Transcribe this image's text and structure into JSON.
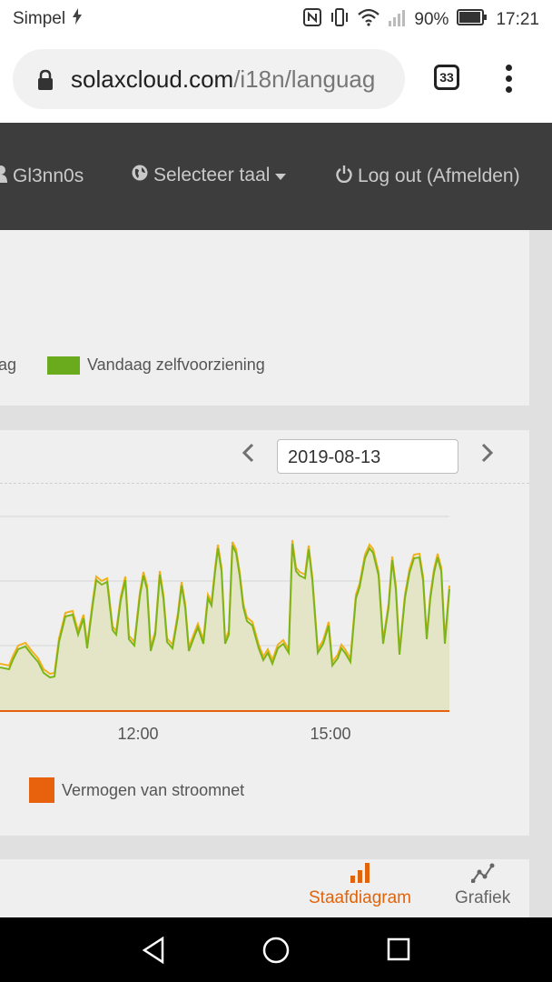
{
  "status_bar": {
    "carrier": "Simpel",
    "battery_percent": "90%",
    "time": "17:21",
    "icons": [
      "charging-bolt-icon",
      "nfc-icon",
      "vibrate-icon",
      "wifi-icon",
      "signal-icon",
      "battery-icon"
    ]
  },
  "browser": {
    "url_domain": "solaxcloud.com",
    "url_path": "/i18n/languag",
    "tab_count": "33"
  },
  "site_nav": {
    "user": "Gl3nn0s",
    "language": "Selecteer taal",
    "logout": "Log out (Afmelden)"
  },
  "summary_panel": {
    "legend_partial": "ag",
    "legend_selfsufficiency": "Vandaag zelfvoorziening",
    "legend_color": "#6aaa1d"
  },
  "power_panel": {
    "date": "2019-08-13",
    "legend_grid": "Vermogen van stroomnet",
    "legend_grid_color": "#e8620d"
  },
  "chart_data": {
    "type": "area",
    "x_tick_labels": [
      "12:00",
      "15:00"
    ],
    "series_colors": {
      "yield": "#f2b01c",
      "consumption": "#7cb518",
      "grid": "#e8620d"
    },
    "grid": true
  },
  "bottom_toolbar": {
    "bar_chart_label": "Staafdiagram",
    "line_chart_label": "Grafiek",
    "active_color": "#e0640c"
  }
}
